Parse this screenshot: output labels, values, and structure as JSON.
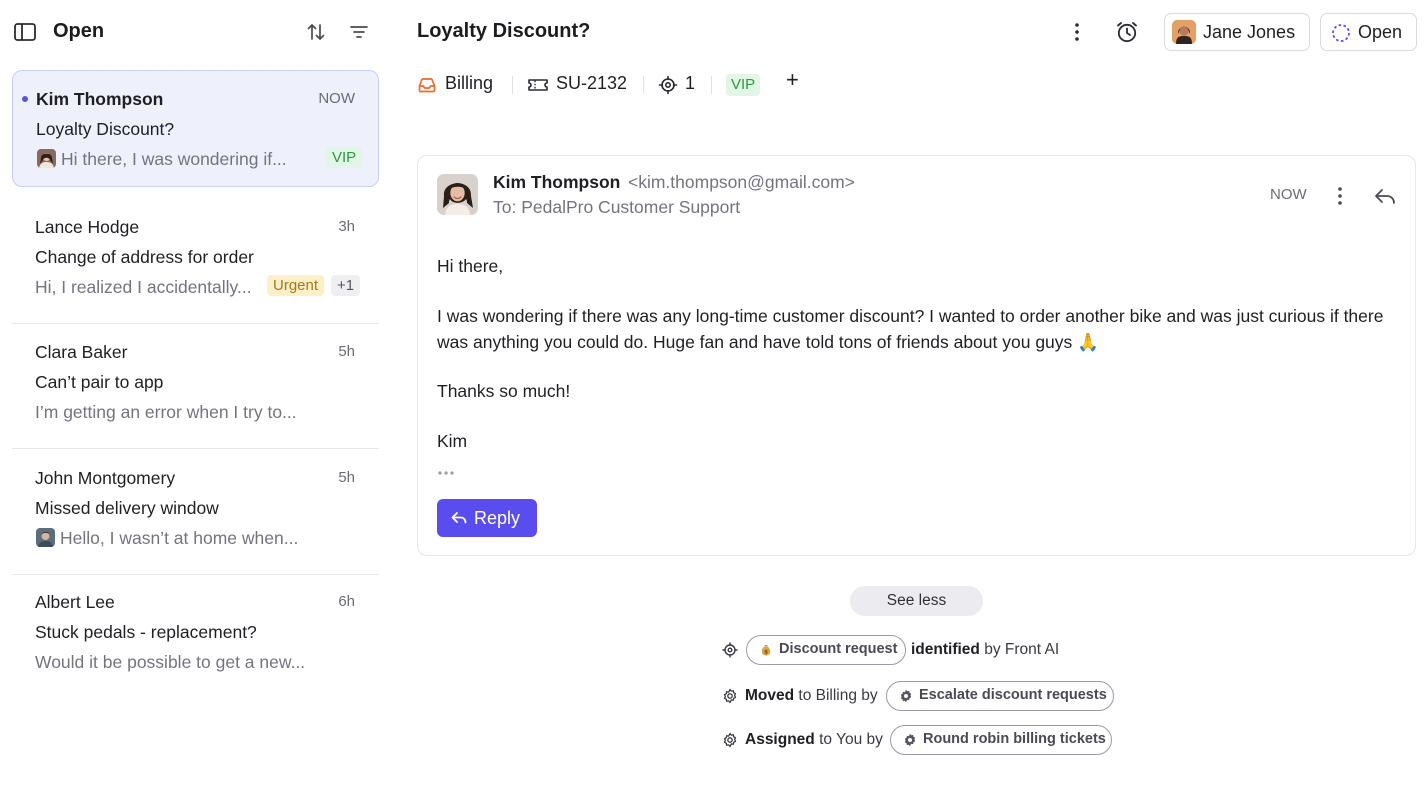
{
  "sidebar": {
    "title": "Open",
    "conversations": [
      {
        "name": "Kim Thompson",
        "time": "NOW",
        "subject": "Loyalty Discount?",
        "preview": "Hi there, I was wondering if...",
        "tags": [
          "VIP"
        ],
        "unread": true,
        "active": true
      },
      {
        "name": "Lance Hodge",
        "time": "3h",
        "subject": "Change of address for order",
        "preview": "Hi, I realized I accidentally...",
        "tags": [
          "Urgent",
          "+1"
        ]
      },
      {
        "name": "Clara Baker",
        "time": "5h",
        "subject": "Can’t pair to app",
        "preview": "I’m getting an error when I try to..."
      },
      {
        "name": "John Montgomery",
        "time": "5h",
        "subject": "Missed delivery window",
        "preview": "Hello, I wasn’t at home when..."
      },
      {
        "name": "Albert Lee",
        "time": "6h",
        "subject": "Stuck pedals - replacement?",
        "preview": "Would it be possible to get a new..."
      }
    ]
  },
  "header": {
    "title": "Loyalty Discount?",
    "assignee": "Jane Jones",
    "status": "Open"
  },
  "meta": {
    "inbox": "Billing",
    "ticket": "SU-2132",
    "count": "1",
    "tag": "VIP",
    "add": "+"
  },
  "message": {
    "from_name": "Kim Thompson",
    "from_email": "<kim.thompson@gmail.com>",
    "to": "To: PedalPro Customer Support",
    "time": "NOW",
    "greeting": "Hi there,",
    "body": "I was wondering if there was any long-time customer discount? I wanted to order another bike and was just curious if there was anything you could do. Huge fan and have told tons of friends about you guys 🙏",
    "thanks": "Thanks so much!",
    "signature": "Kim",
    "reply_label": "Reply"
  },
  "activity": {
    "see_less": "See less",
    "items": [
      {
        "pill": "Discount request",
        "verb": "identified",
        "rest": "by Front AI"
      },
      {
        "verb": "Moved",
        "rest": "to Billing by",
        "pill": "Escalate discount requests"
      },
      {
        "verb": "Assigned",
        "rest": "to You by",
        "pill": "Round robin billing tickets"
      }
    ]
  },
  "colors": {
    "accent": "#5a4df0",
    "active_bg": "#eef0fc",
    "vip_bg": "#e2f6e6",
    "vip_text": "#2b9a47",
    "urgent_bg": "#fdf0c9",
    "urgent_text": "#a7781a",
    "inbox_icon": "#f06a2a"
  }
}
